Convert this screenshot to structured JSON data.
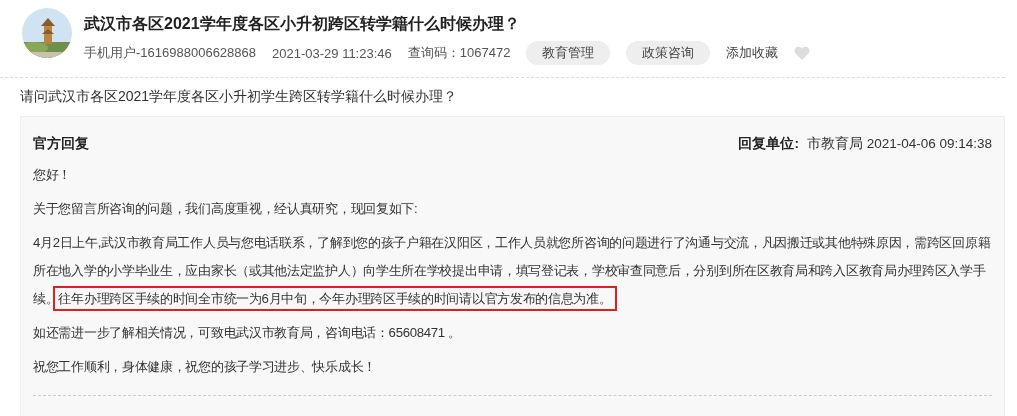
{
  "post": {
    "title": "武汉市各区2021学年度各区小升初跨区转学籍什么时候办理？",
    "author": "手机用户-1616988006628868",
    "time": "2021-03-29 11:23:46",
    "query_code": "查询码：1067472",
    "tags": [
      "教育管理",
      "政策咨询"
    ],
    "favorite": {
      "label": "添加收藏",
      "liked": false
    },
    "question": "请问武汉市各区2021学年度各区小升初学生跨区转学籍什么时候办理？"
  },
  "reply": {
    "heading": "官方回复",
    "unit_label": "回复单位:",
    "unit": "市教育局 2021-04-06 09:14:38",
    "paragraphs": [
      {
        "text": "您好！"
      },
      {
        "text": "关于您留言所咨询的问题，我们高度重视，经认真研究，现回复如下:"
      },
      {
        "text": "4月2日上午,武汉市教育局工作人员与您电话联系，了解到您的孩子户籍在汉阳区，工作人员就您所咨询的问题进行了沟通与交流，凡因搬迁或其他特殊原因，需跨区回原籍所在地入学的小学毕业生，应由家长（或其他法定监护人）向学生所在学校提出申请，填写登记表，学校审查同意后，分别到所在区教育局和跨入区教育局办理跨区入学手续。",
        "highlight": "往年办理跨区手续的时间全市统一为6月中旬，今年办理跨区手续的时间请以官方发布的信息为准。"
      },
      {
        "text": "如还需进一步了解相关情况，可致电武汉市教育局，咨询电话：65608471 。"
      },
      {
        "text": "祝您工作顺利，身体健康，祝您的孩子学习进步、快乐成长！"
      }
    ]
  }
}
